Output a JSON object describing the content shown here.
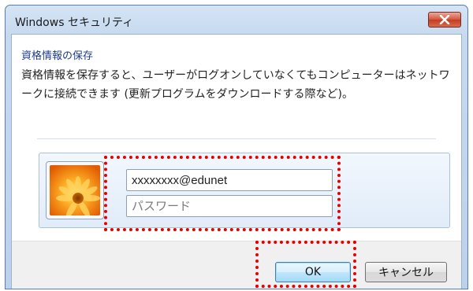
{
  "window": {
    "title": "Windows セキュリティ"
  },
  "dialog": {
    "section_title": "資格情報の保存",
    "description": "資格情報を保存すると、ユーザーがログオンしていなくてもコンピューターはネットワークに接続できます (更新プログラムをダウンロードする際など)。"
  },
  "credentials": {
    "username_value": "xxxxxxxx@edunet",
    "password_value": "",
    "password_placeholder": "パスワード",
    "avatar_icon": "user-flower-avatar-icon"
  },
  "buttons": {
    "ok_label": "OK",
    "cancel_label": "キャンセル"
  },
  "icons": {
    "close": "close-icon"
  },
  "colors": {
    "highlight": "#e60000",
    "close_button": "#c8452b",
    "section_title": "#1e3b8a"
  }
}
